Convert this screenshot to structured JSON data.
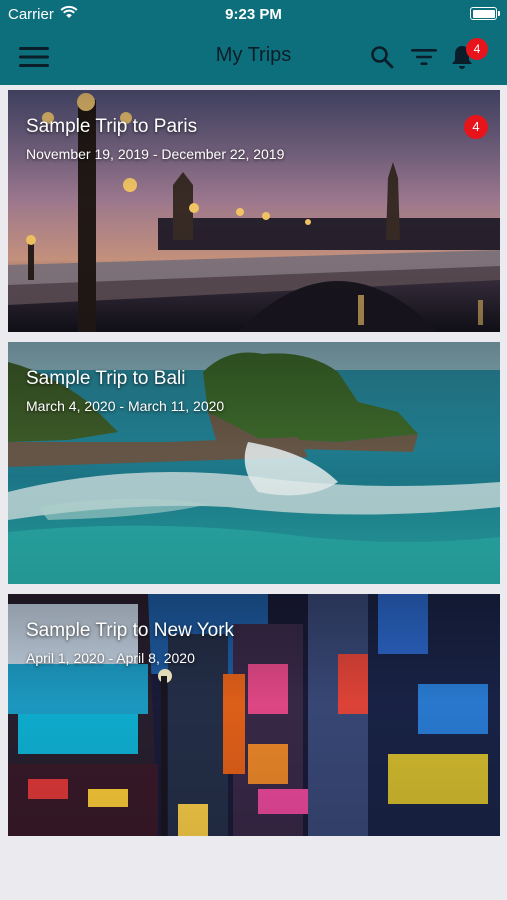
{
  "status_bar": {
    "carrier": "Carrier",
    "time": "9:23 PM"
  },
  "header": {
    "title": "My Trips",
    "notification_count": "4",
    "icons": [
      "menu-icon",
      "search-icon",
      "filter-icon",
      "bell-icon"
    ]
  },
  "trips": [
    {
      "title": "Sample Trip to Paris",
      "dates": "November 19, 2019 - December 22, 2019",
      "badge": "4"
    },
    {
      "title": "Sample Trip to Bali",
      "dates": "March 4, 2020 - March 11, 2020"
    },
    {
      "title": "Sample Trip to New York",
      "dates": "April 1, 2020 - April 8, 2020"
    }
  ],
  "colors": {
    "header": "#0e6f7c",
    "badge": "#e8141b",
    "background": "#ebebef"
  }
}
